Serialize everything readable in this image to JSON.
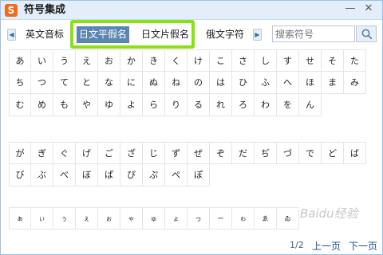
{
  "window": {
    "title": "符号集成",
    "logo_text": "S",
    "minimize_glyph": "—",
    "close_glyph": "✕"
  },
  "tabs": [
    {
      "label": "英文音标"
    },
    {
      "label": "日文平假名",
      "selected": true
    },
    {
      "label": "日文片假名"
    },
    {
      "label": "俄文字符"
    }
  ],
  "nav": {
    "left_glyph": "◀",
    "right_glyph": "▶"
  },
  "search": {
    "placeholder": "搜索符号",
    "icon": "search-icon"
  },
  "highlight_color": "#88e20b",
  "selected_tab_color": "#5b86b1",
  "grid1": [
    "あ",
    "い",
    "う",
    "え",
    "お",
    "か",
    "き",
    "く",
    "け",
    "こ",
    "さ",
    "し",
    "す",
    "せ",
    "そ",
    "た",
    "ち",
    "つ",
    "て",
    "と",
    "な",
    "に",
    "ぬ",
    "ね",
    "の",
    "は",
    "ひ",
    "ふ",
    "へ",
    "ほ",
    "ま",
    "み",
    "む",
    "め",
    "も",
    "や",
    "ゆ",
    "よ",
    "ら",
    "り",
    "る",
    "れ",
    "ろ",
    "わ",
    "を",
    "ん"
  ],
  "grid2": [
    "が",
    "ぎ",
    "ぐ",
    "げ",
    "ご",
    "ざ",
    "じ",
    "ず",
    "ぜ",
    "ぞ",
    "だ",
    "ぢ",
    "づ",
    "で",
    "ど",
    "ば",
    "び",
    "ぶ",
    "べ",
    "ぼ",
    "ぱ",
    "ぴ",
    "ぷ",
    "ぺ",
    "ぽ"
  ],
  "grid3": [
    "ぁ",
    "ぃ",
    "ぅ",
    "ぇ",
    "ぉ",
    "ゃ",
    "ゅ",
    "ょ",
    "っ",
    "ー",
    "ゎ",
    "ゑ",
    "ゐ"
  ],
  "footer": {
    "page": "1/2",
    "prev": "上一页",
    "next": "下一页"
  },
  "watermark": "Baidu经验"
}
